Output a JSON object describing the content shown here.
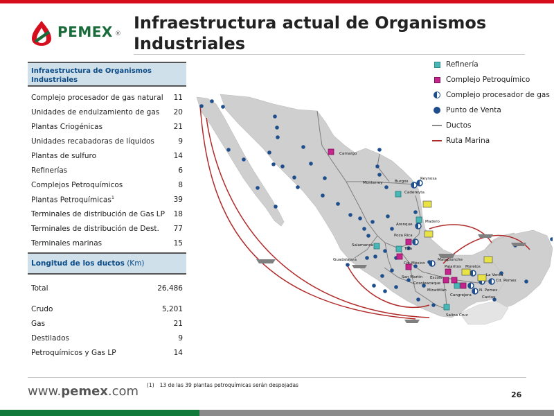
{
  "brand": {
    "name": "PEMEX",
    "registered": "®",
    "url_prefix": "www.",
    "url_bold": "pemex",
    "url_suffix": ".com"
  },
  "title": "Infraestructura actual de Organismos Industriales",
  "table1": {
    "header": "Infraestructura de Organismos Industriales",
    "rows": [
      {
        "label": "Complejo procesador de gas natural",
        "value": "11"
      },
      {
        "label": "Unidades de endulzamiento de gas",
        "value": "20"
      },
      {
        "label": "Plantas Criogénicas",
        "value": "21"
      },
      {
        "label": "Unidades recabadoras de líquidos",
        "value": "9"
      },
      {
        "label": "Plantas de sulfuro",
        "value": "14"
      },
      {
        "label": "Refinerías",
        "value": "6"
      },
      {
        "label": "Complejos Petroquímicos",
        "value": "8"
      },
      {
        "label": "Plantas Petroquímicas",
        "sup": "1",
        "value": "39"
      },
      {
        "label": "Terminales de distribución de Gas LP",
        "value": "18"
      },
      {
        "label": "Terminales de distribución de Dest.",
        "value": "77"
      },
      {
        "label": "Terminales marinas",
        "value": "15"
      }
    ]
  },
  "table2": {
    "header_bold": "Longitud de los ductos",
    "header_unit": " (Km)",
    "total": {
      "label": "Total",
      "value": "26,486"
    },
    "rows": [
      {
        "label": "Crudo",
        "value": "5,201"
      },
      {
        "label": "Gas",
        "value": "21"
      },
      {
        "label": "Destilados",
        "value": "9"
      },
      {
        "label": "Petroquímicos y Gas LP",
        "value": "14"
      }
    ]
  },
  "legend": [
    {
      "label": "Refinería",
      "icon": "refinery-icon"
    },
    {
      "label": "Complejo Petroquímico",
      "icon": "petrochemical-complex-icon"
    },
    {
      "label": "Complejo procesador de gas",
      "icon": "gas-processor-icon"
    },
    {
      "label": "Punto de Venta",
      "icon": "point-of-sale-icon"
    },
    {
      "label": "Ductos",
      "icon": "pipeline-line-icon"
    },
    {
      "label": "Ruta Marina",
      "icon": "marine-route-icon"
    }
  ],
  "map_places": {
    "camargo": "Camargo",
    "reynosa": "Reynosa",
    "burgos": "Burgos",
    "cadereyta": "Cadereyta",
    "monterrey": "Monterrey",
    "madero": "Madero",
    "arenque": "Arenque",
    "poza_rica": "Poza Rica",
    "salamanca": "Salamanca",
    "tula": "Tula",
    "guadalajara": "Guadalajara",
    "cd_mexico": "Cd. México",
    "san_martin": "San Martín",
    "escolin": "Escolín",
    "matapionche": "Matapionche",
    "pajaritos": "Pajaritos",
    "morelos": "Morelos",
    "la_venta": "La Venta",
    "cd_pemex": "Cd. Pemex",
    "cosoleacaque": "Cosoleacaque",
    "minatitlan": "Minatitlán",
    "n_pemex": "N. Pemex",
    "cangrejera": "Cangrejera",
    "cactus": "Cactus",
    "salina_cruz": "Salina Cruz"
  },
  "colors": {
    "accent_red": "#d60d1c",
    "brand_green": "#1a6b3a",
    "header_blue": "#0b4a86",
    "header_bg": "#cfe0ea",
    "map_land": "#cfcfcf",
    "marine_route": "#b02a2a",
    "pipeline": "#7d7d7d",
    "point_of_sale": "#1f4e8c"
  },
  "footnote": {
    "num": "(1)",
    "text": "13 de las 39 plantas petroquímicas serán despojadas"
  },
  "page_number": "26"
}
